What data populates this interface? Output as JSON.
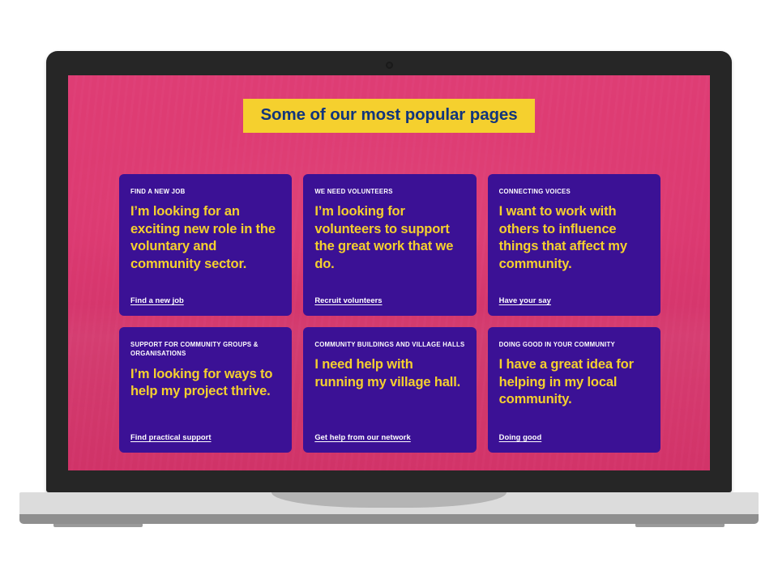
{
  "page": {
    "title": "Some of our most popular pages",
    "background_overlay_color": "#dd3971",
    "card_color": "#3b1195",
    "accent_yellow": "#f5d02e",
    "title_text_color": "#11357d"
  },
  "cards": [
    {
      "eyebrow": "FIND A NEW JOB",
      "headline": "I’m looking for an exciting new role in the voluntary and community sector.",
      "link": "Find a new job"
    },
    {
      "eyebrow": "WE NEED VOLUNTEERS",
      "headline": "I’m looking for volunteers to support the great work that we do.",
      "link": "Recruit volunteers"
    },
    {
      "eyebrow": "CONNECTING VOICES",
      "headline": "I want to work with others to influence things that affect my community.",
      "link": "Have your say"
    },
    {
      "eyebrow": "SUPPORT FOR COMMUNITY GROUPS & ORGANISATIONS",
      "headline": "I’m looking for ways to help my project thrive.",
      "link": "Find practical support"
    },
    {
      "eyebrow": "COMMUNITY BUILDINGS AND VILLAGE HALLS",
      "headline": "I need help with running my village hall.",
      "link": "Get help from our network"
    },
    {
      "eyebrow": "DOING GOOD IN YOUR COMMUNITY",
      "headline": "I have a great idea for helping in my local community.",
      "link": "Doing good"
    }
  ]
}
